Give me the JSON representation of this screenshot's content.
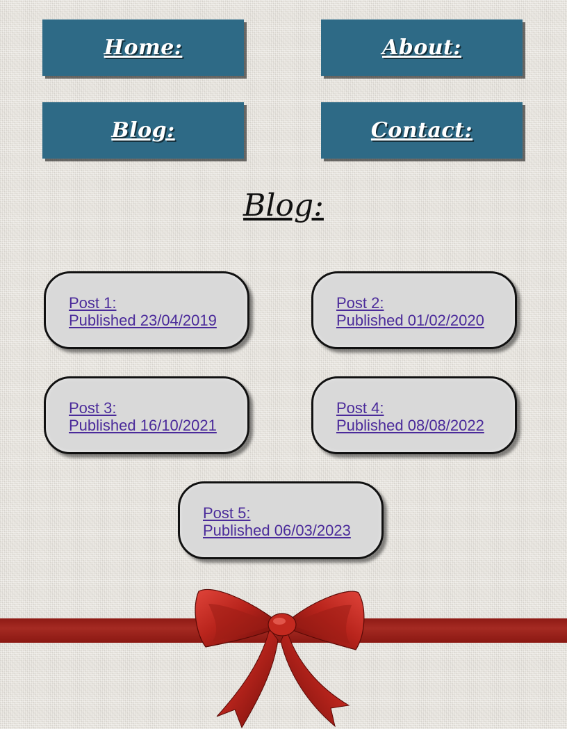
{
  "nav": {
    "home_label": "Home:",
    "about_label": "About:",
    "blog_label": "Blog:",
    "contact_label": "Contact:"
  },
  "page": {
    "title": "Blog:"
  },
  "posts": [
    {
      "title": "Post 1:",
      "published": "Published 23/04/2019"
    },
    {
      "title": "Post 2:",
      "published": "Published 01/02/2020"
    },
    {
      "title": "Post 3:",
      "published": "Published 16/10/2021"
    },
    {
      "title": "Post 4:",
      "published": "Published 08/08/2022"
    },
    {
      "title": "Post 5:",
      "published": "Published 06/03/2023"
    }
  ],
  "colors": {
    "nav_button_bg": "#2e6a86",
    "card_bg": "#d9d9d9",
    "link": "#4a2a9a",
    "ribbon": "#a52a22"
  },
  "decoration": {
    "bow_icon": "red-ribbon-bow-icon"
  }
}
